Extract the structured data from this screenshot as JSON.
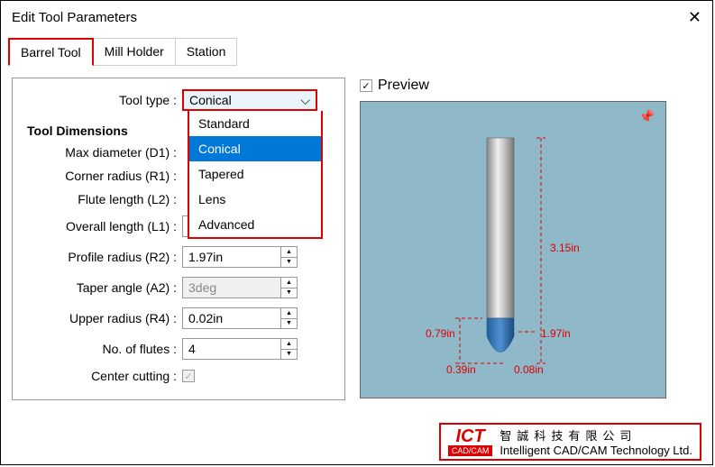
{
  "window": {
    "title": "Edit Tool Parameters"
  },
  "tabs": [
    {
      "label": "Barrel Tool",
      "active": true
    },
    {
      "label": "Mill Holder",
      "active": false
    },
    {
      "label": "Station",
      "active": false
    }
  ],
  "tool_type": {
    "label": "Tool type :",
    "value": "Conical",
    "options": [
      "Standard",
      "Conical",
      "Tapered",
      "Lens",
      "Advanced"
    ]
  },
  "section_header": "Tool Dimensions",
  "params": {
    "max_diameter": {
      "label": "Max diameter (D1) :",
      "value": ""
    },
    "corner_radius": {
      "label": "Corner radius (R1) :",
      "value": ""
    },
    "flute_length": {
      "label": "Flute length (L2) :",
      "value": ""
    },
    "overall_length": {
      "label": "Overall length (L1) :",
      "value": "3.15in"
    },
    "profile_radius": {
      "label": "Profile radius (R2) :",
      "value": "1.97in"
    },
    "taper_angle": {
      "label": "Taper angle (A2) :",
      "value": "3deg",
      "disabled": true
    },
    "upper_radius": {
      "label": "Upper radius (R4) :",
      "value": "0.02in"
    },
    "no_flutes": {
      "label": "No. of flutes :",
      "value": "4"
    },
    "center_cutting": {
      "label": "Center cutting :",
      "checked": true,
      "disabled": true
    }
  },
  "preview": {
    "label": "Preview",
    "checked": true,
    "dims": {
      "height": "3.15in",
      "flute": "0.79in",
      "profile": "1.97in",
      "lower1": "0.39in",
      "lower2": "0.08in"
    }
  },
  "logo": {
    "ict": "ICT",
    "sub": "CAD/CAM",
    "cn": "智誠科技有限公司",
    "en": "Intelligent CAD/CAM Technology Ltd."
  }
}
